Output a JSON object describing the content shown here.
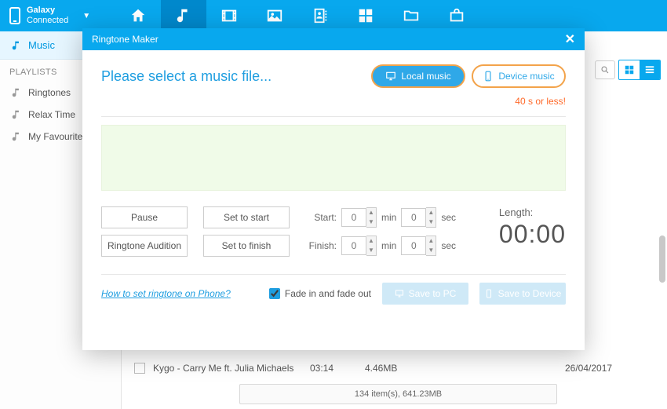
{
  "header": {
    "device_name": "Galaxy",
    "device_status": "Connected"
  },
  "sidebar": {
    "tab": "Music",
    "playlists_head": "PLAYLISTS",
    "items": [
      "Ringtones",
      "Relax Time",
      "My Favourite"
    ]
  },
  "track": {
    "name": "Kygo - Carry Me ft. Julia Michaels",
    "duration": "03:14",
    "size": "4.46MB",
    "date": "26/04/2017"
  },
  "status": "134 item(s), 641.23MB",
  "modal": {
    "title": "Ringtone Maker",
    "prompt": "Please select a music file...",
    "local_btn": "Local music",
    "device_btn": "Device music",
    "limit": "40 s or less!",
    "pause": "Pause",
    "set_start": "Set to start",
    "audition": "Ringtone Audition",
    "set_finish": "Set to finish",
    "start_label": "Start:",
    "finish_label": "Finish:",
    "min_unit": "min",
    "sec_unit": "sec",
    "start_min": "0",
    "start_sec": "0",
    "finish_min": "0",
    "finish_sec": "0",
    "length_label": "Length:",
    "length_value": "00:00",
    "help": "How to set ringtone on Phone?",
    "fade_label": "Fade in and fade out",
    "save_pc": "Save to PC",
    "save_device": "Save to Device"
  }
}
